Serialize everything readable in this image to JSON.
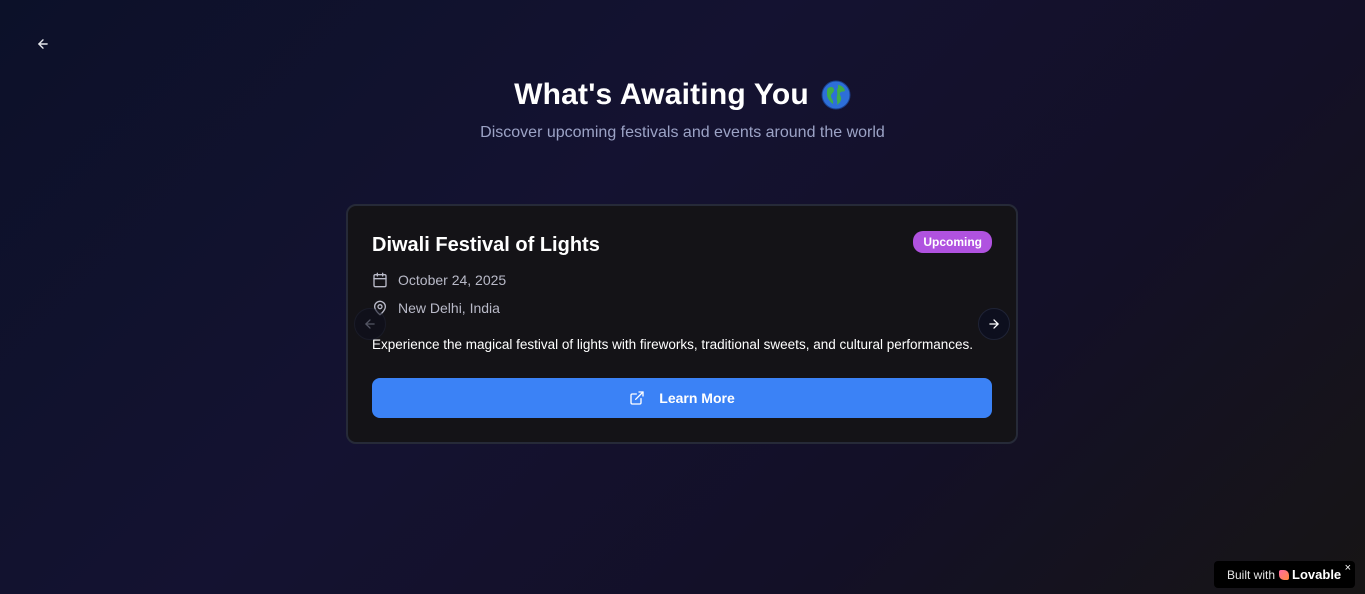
{
  "header": {
    "title": "What's Awaiting You",
    "subtitle": "Discover upcoming festivals and events around the world"
  },
  "icons": {
    "back": "arrow-left-icon",
    "globe": "globe-emoji-icon",
    "calendar": "calendar-icon",
    "location": "map-pin-icon",
    "external": "external-link-icon",
    "prev": "arrow-left-icon",
    "next": "arrow-right-icon"
  },
  "event": {
    "title": "Diwali Festival of Lights",
    "status": "Upcoming",
    "date": "October 24, 2025",
    "location": "New Delhi, India",
    "description": "Experience the magical festival of lights with fireworks, traditional sweets, and cultural performances.",
    "button_label": "Learn More"
  },
  "footer_badge": {
    "prefix": "Built with",
    "brand": "Lovable",
    "close": "×"
  },
  "colors": {
    "accent": "#3b82f6",
    "badge": "#b052e0",
    "card_bg": "#141317",
    "page_bg_start": "#0c1129"
  }
}
